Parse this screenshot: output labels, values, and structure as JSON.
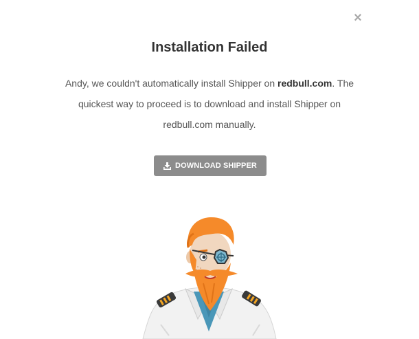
{
  "dialog": {
    "close_symbol": "×",
    "title": "Installation Failed",
    "message": {
      "part1": "Andy, we couldn't automatically install Shipper on ",
      "site": "redbull.com",
      "part2": ". The quickest way to proceed is to download and install Shipper on redbull.com manually."
    },
    "download_button": {
      "label": "DOWNLOAD SHIPPER",
      "icon": "download-icon"
    },
    "illustration": "captain-mascot-illustration"
  },
  "colors": {
    "title": "#333333",
    "text": "#555555",
    "button_bg": "#8c8c8c",
    "close": "#a8a8a8",
    "mascot_hair": "#f58a2a",
    "mascot_shirt": "#f2f2f2",
    "mascot_scarf": "#4a97b8"
  }
}
